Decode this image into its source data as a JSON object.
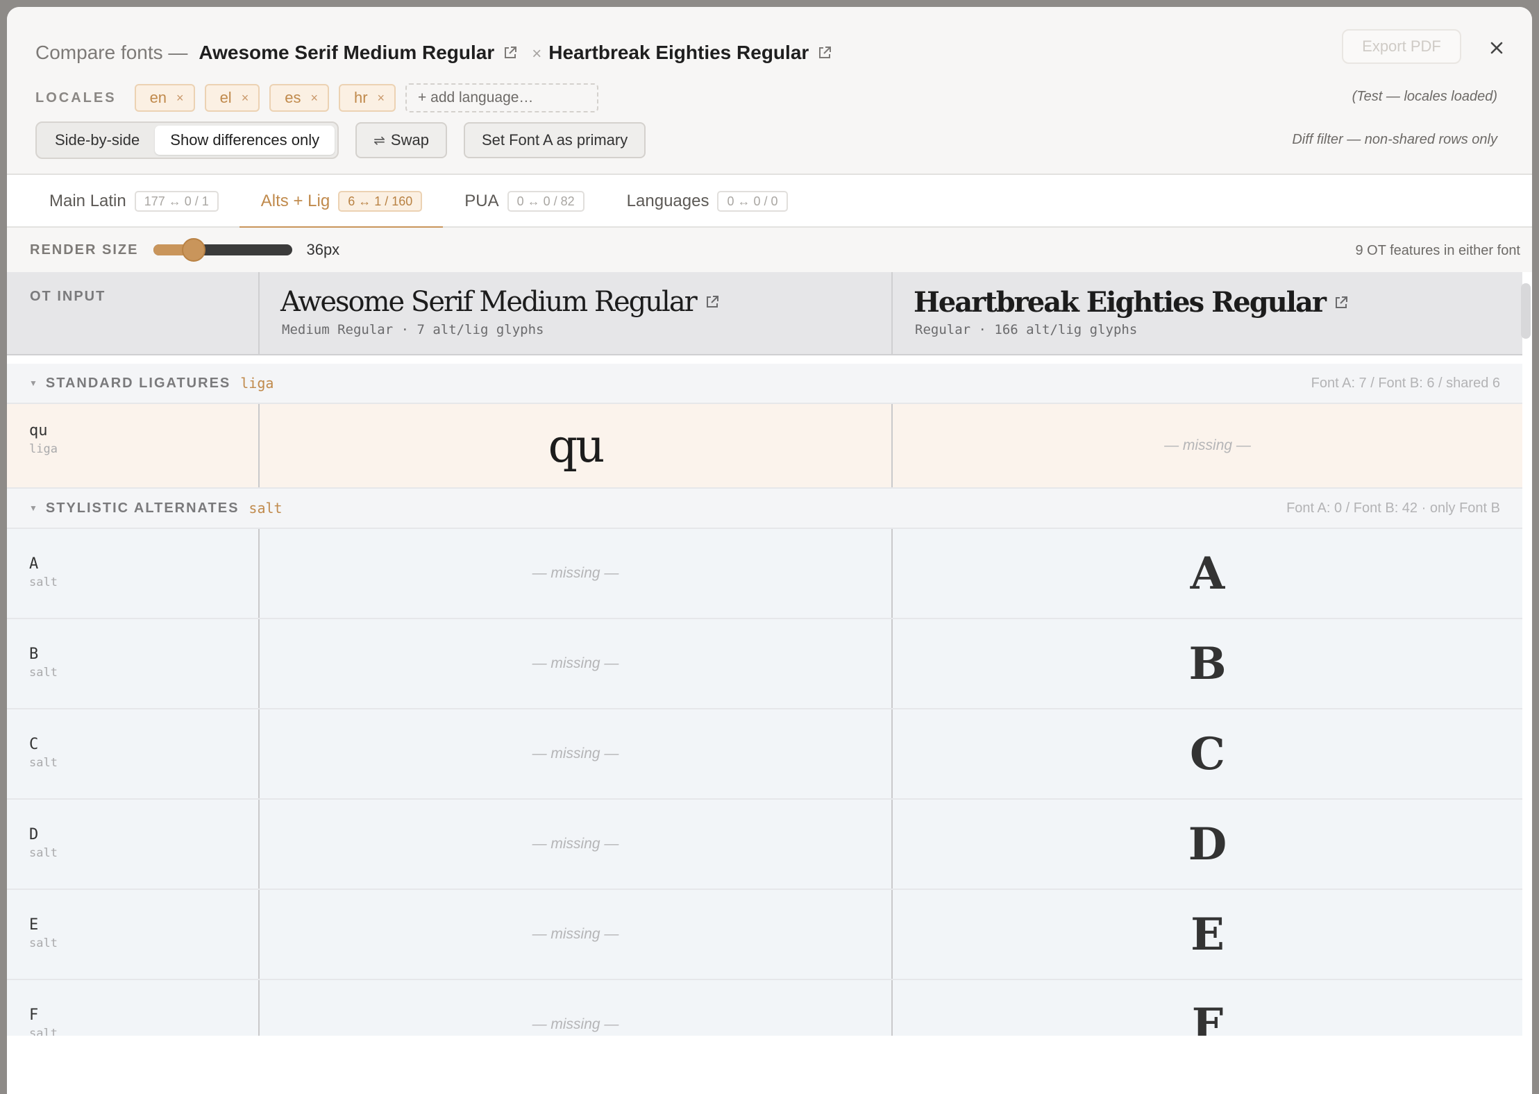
{
  "dialog": {
    "title_prefix": "Compare fonts —",
    "font_a": "Awesome Serif Medium Regular",
    "font_b": "Heartbreak Eighties Regular",
    "separator": "×",
    "export_label": "Export PDF"
  },
  "locales": {
    "label": "LOCALES",
    "chips": [
      {
        "code": "en",
        "remove": "×"
      },
      {
        "code": "el",
        "remove": "×"
      },
      {
        "code": "es",
        "remove": "×"
      },
      {
        "code": "hr",
        "remove": "×"
      }
    ],
    "add_placeholder": "+ add language…",
    "note": "(Test — locales loaded)"
  },
  "controls": {
    "view_modes": [
      "Side-by-side",
      "Show differences only"
    ],
    "active_mode": "Show differences only",
    "swap_label": "Swap",
    "swap_glyph": "⇌",
    "primary_label": "Set Font A as primary",
    "note": "Diff filter — non-shared rows only"
  },
  "tabs": [
    {
      "label": "Main Latin",
      "count": "177 ↔ 0 / 1"
    },
    {
      "label": "Alts + Lig",
      "count": "6 ↔ 1 / 160"
    },
    {
      "label": "PUA",
      "count": "0 ↔ 0 / 82"
    },
    {
      "label": "Languages",
      "count": "0 ↔ 0 / 0"
    }
  ],
  "active_tab": "Alts + Lig",
  "render": {
    "label": "RENDER SIZE",
    "value": "36px",
    "slider_fraction": 0.29,
    "note": "9 OT features in either font"
  },
  "columns": {
    "input_label": "OT INPUT",
    "font_a": {
      "name": "Awesome Serif Medium Regular",
      "sub": "Medium Regular · 7 alt/lig glyphs"
    },
    "font_b": {
      "name": "Heartbreak Eighties Regular",
      "sub": "Regular · 166 alt/lig glyphs"
    }
  },
  "sections": [
    {
      "name": "STANDARD LIGATURES",
      "tag": "liga",
      "summary": "Font A: 7 / Font B: 6 / shared 6",
      "rows": [
        {
          "input": "qu",
          "feature": "liga",
          "a": "qu",
          "b": "— missing —"
        }
      ]
    },
    {
      "name": "STYLISTIC ALTERNATES",
      "tag": "salt",
      "summary": "Font A: 0 / Font B: 42 · only Font B",
      "rows": [
        {
          "input": "A",
          "feature": "salt",
          "a": "— missing —",
          "b": "A"
        },
        {
          "input": "B",
          "feature": "salt",
          "a": "— missing —",
          "b": "B"
        },
        {
          "input": "C",
          "feature": "salt",
          "a": "— missing —",
          "b": "C"
        },
        {
          "input": "D",
          "feature": "salt",
          "a": "— missing —",
          "b": "D"
        },
        {
          "input": "E",
          "feature": "salt",
          "a": "— missing —",
          "b": "E"
        },
        {
          "input": "F",
          "feature": "salt",
          "a": "— missing —",
          "b": "F"
        }
      ]
    }
  ],
  "colors": {
    "accent": "#c9955b",
    "diff_row": "#fbf3ec",
    "b_only_row": "#f2f5f8"
  }
}
